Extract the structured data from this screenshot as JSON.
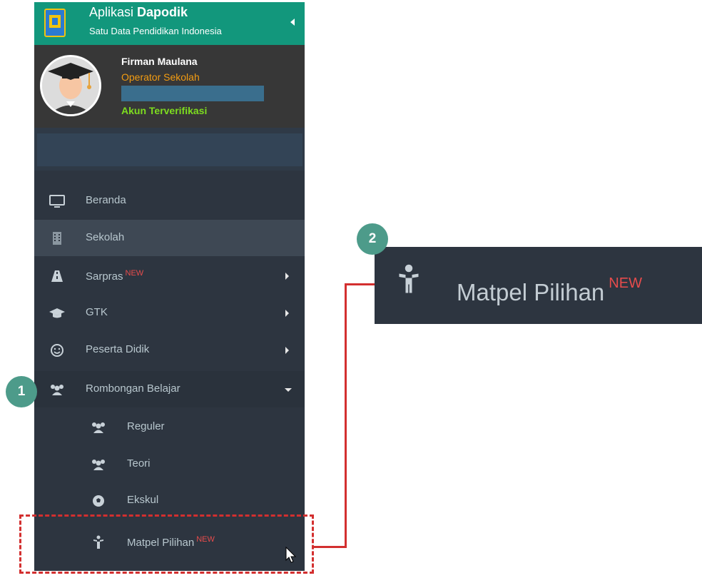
{
  "app": {
    "title_prefix": "Aplikasi",
    "title_bold": "Dapodik",
    "subtitle": "Satu Data Pendidikan Indonesia"
  },
  "profile": {
    "name": "Firman Maulana",
    "role": "Operator Sekolah",
    "status": "Akun Terverifikasi"
  },
  "menu": {
    "items": [
      {
        "label": "Beranda",
        "icon": "monitor-icon"
      },
      {
        "label": "Sekolah",
        "icon": "building-icon"
      },
      {
        "label": "Sarpras",
        "badge": "NEW",
        "icon": "road-icon"
      },
      {
        "label": "GTK",
        "icon": "graduation-cap-icon"
      },
      {
        "label": "Peserta Didik",
        "icon": "smile-icon"
      },
      {
        "label": "Rombongan Belajar",
        "icon": "users-icon"
      }
    ],
    "sub_items": [
      {
        "label": "Reguler",
        "icon": "users-icon"
      },
      {
        "label": "Teori",
        "icon": "users-icon"
      },
      {
        "label": "Ekskul",
        "icon": "soccer-ball-icon"
      },
      {
        "label": "Matpel Pilihan",
        "badge": "NEW",
        "icon": "child-icon"
      }
    ]
  },
  "zoom": {
    "label": "Matpel Pilihan",
    "badge": "NEW"
  },
  "steps": {
    "one": "1",
    "two": "2"
  },
  "colors": {
    "brand": "#12977c",
    "sidebar": "#2d3540",
    "badge_new": "#e74c4c",
    "highlight": "#d32f2f",
    "step": "#4d9b8a"
  }
}
